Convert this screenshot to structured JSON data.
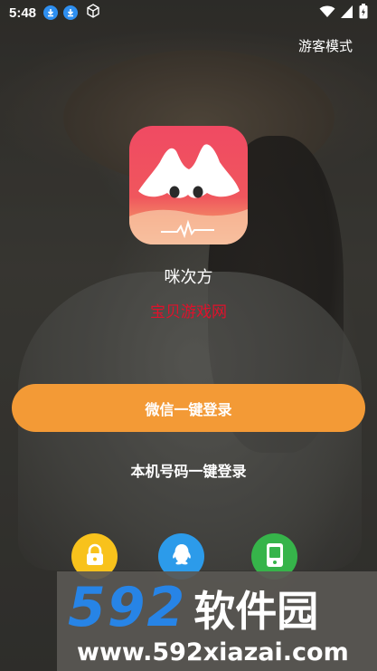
{
  "status_bar": {
    "time": "5:48",
    "left_icons": [
      "download-icon",
      "download-icon",
      "cube-icon"
    ],
    "right_icons": [
      "wifi-icon",
      "signal-icon",
      "battery-icon"
    ]
  },
  "header": {
    "guest_mode_label": "游客模式"
  },
  "app": {
    "name": "咪次方",
    "logo_icon": "app-logo"
  },
  "watermark_text": "宝贝游戏网",
  "buttons": {
    "wechat_login": "微信一键登录",
    "phone_login": "本机号码一键登录"
  },
  "alt_login_icons": [
    {
      "icon": "lock-icon",
      "color": "#f8c21c"
    },
    {
      "icon": "qq-icon",
      "color": "#2c9bea"
    },
    {
      "icon": "phone-icon",
      "color": "#36b44a"
    }
  ],
  "banner": {
    "number": "592",
    "title": "软件园",
    "url": "www.592xiazai.com"
  },
  "colors": {
    "accent": "#f39a36",
    "watermark": "#e0112b",
    "banner_blue": "#2784e6"
  }
}
